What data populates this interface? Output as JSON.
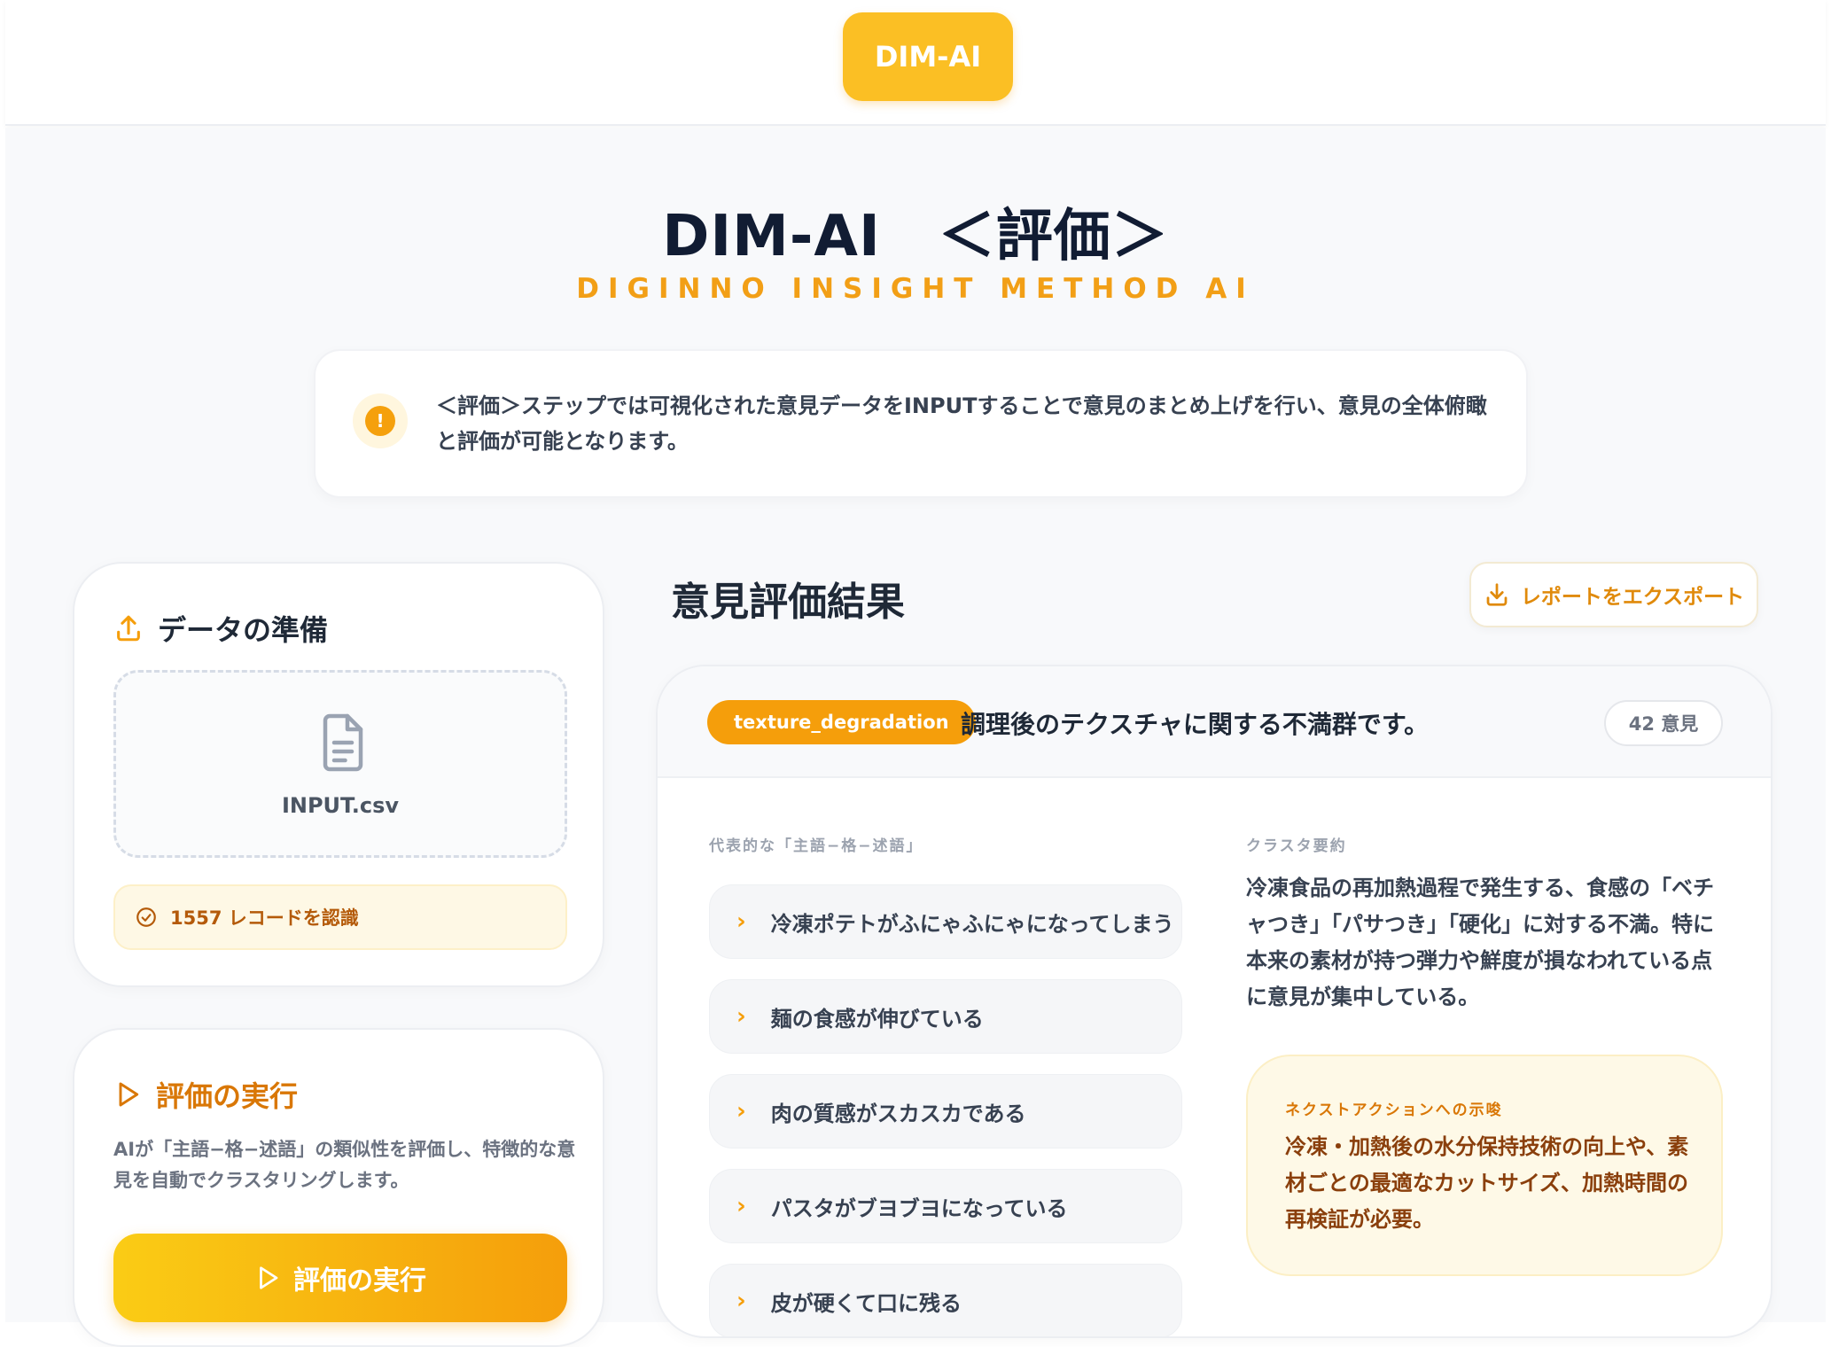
{
  "header": {
    "logo_label": "DIM-AI"
  },
  "hero": {
    "title": "DIM-AI　＜評価＞",
    "subtitle": "DIGINNO INSIGHT METHOD AI"
  },
  "notice": {
    "icon": "exclamation-icon",
    "text": "＜評価＞ステップでは可視化された意見データをINPUTすることで意見のまとめ上げを行い、意見の全体俯瞰と評価が可能となります。"
  },
  "prep": {
    "title": "データの準備",
    "file_name": "INPUT.csv",
    "records_status": "1557 レコードを認識"
  },
  "exec": {
    "title": "評価の実行",
    "description": "AIが「主語−格−述語」の類似性を評価し、特徴的な意見を自動でクラスタリングします。",
    "button_label": "評価の実行"
  },
  "results": {
    "title": "意見評価結果",
    "export_label": "レポートをエクスポート",
    "cluster": {
      "tag": "texture_degradation",
      "title": "調理後のテクスチャに関する不満群です。",
      "count": "42 意見",
      "phrases_label": "代表的な「主語−格−述語」",
      "phrases": [
        "冷凍ポテトがふにゃふにゃになってしまう",
        "麺の食感が伸びている",
        "肉の質感がスカスカである",
        "パスタがブヨブヨになっている",
        "皮が硬くて口に残る"
      ],
      "summary_label": "クラスタ要約",
      "summary": "冷凍食品の再加熱過程で発生する、食感の「ベチャつき」「パサつき」「硬化」に対する不満。特に本来の素材が持つ弾力や鮮度が損なわれている点に意見が集中している。",
      "next_label": "ネクストアクションへの示唆",
      "next_text": "冷凍・加熱後の水分保持技術の向上や、素材ごとの最適なカットサイズ、加熱時間の再検証が必要。"
    }
  },
  "colors": {
    "accent": "#f59e0b",
    "brand_yellow": "#fbbf24",
    "title_dark": "#111c33"
  }
}
